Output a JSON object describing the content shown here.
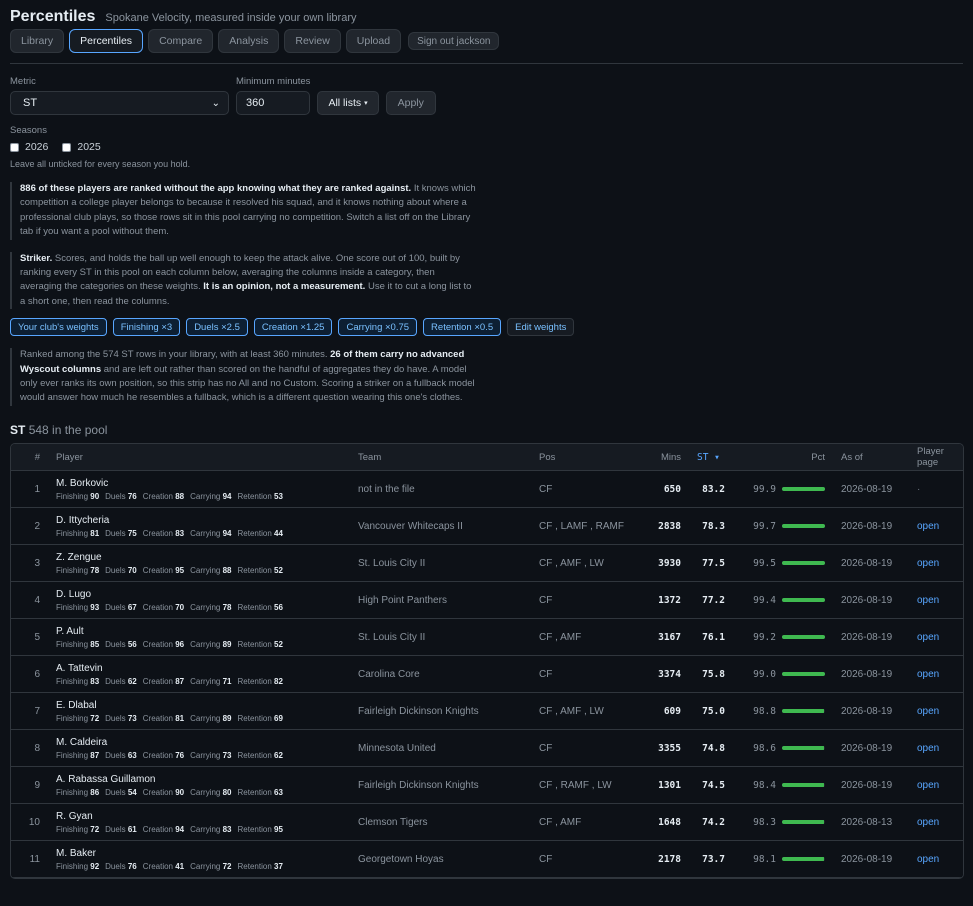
{
  "header": {
    "title": "Percentiles",
    "subtitle": "Spokane Velocity, measured inside your own library"
  },
  "nav": {
    "tabs": [
      "Library",
      "Percentiles",
      "Compare",
      "Analysis",
      "Review",
      "Upload"
    ],
    "active": "Percentiles",
    "signout": "Sign out jackson"
  },
  "filters": {
    "metric_label": "Metric",
    "metric_value": "ST",
    "minmin_label": "Minimum minutes",
    "minmin_value": "360",
    "lists_label": "All lists",
    "apply_label": "Apply",
    "seasons_label": "Seasons",
    "seasons": [
      "2026",
      "2025"
    ],
    "seasons_hint": "Leave all unticked for every season you hold."
  },
  "note1": {
    "bold": "886 of these players are ranked without the app knowing what they are ranked against.",
    "text": " It knows which competition a college player belongs to because it resolved his squad, and it knows nothing about where a professional club plays, so those rows sit in this pool carrying no competition. Switch a list off on the Library tab if you want a pool without them."
  },
  "note2": {
    "bold1": "Striker.",
    "text1": " Scores, and holds the ball up well enough to keep the attack alive. One score out of 100, built by ranking every ST in this pool on each column below, averaging the columns inside a category, then averaging the categories on these weights. ",
    "bold2": "It is an opinion, not a measurement.",
    "text2": " Use it to cut a long list to a short one, then read the columns."
  },
  "weights": {
    "pills": [
      "Your club's weights",
      "Finishing ×3",
      "Duels ×2.5",
      "Creation ×1.25",
      "Carrying ×0.75",
      "Retention ×0.5"
    ],
    "edit": "Edit weights"
  },
  "note3": {
    "text1": "Ranked among the 574 ST rows in your library, with at least 360 minutes. ",
    "bold": "26 of them carry no advanced Wyscout columns",
    "text2": " and are left out rather than scored on the handful of aggregates they do have. A model only ever ranks its own position, so this strip has no All and no Custom. Scoring a striker on a fullback model would answer how much he resembles a fullback, which is a different question wearing this one's clothes."
  },
  "section": {
    "title": "ST",
    "count": "548 in the pool"
  },
  "table": {
    "columns": [
      "#",
      "Player",
      "Team",
      "Pos",
      "Mins",
      "ST ▾",
      "Pct",
      "As of",
      "Player page"
    ],
    "sub_labels": [
      "Finishing",
      "Duels",
      "Creation",
      "Carrying",
      "Retention"
    ],
    "rows": [
      {
        "rank": "1",
        "name": "M. Borkovic",
        "subs": [
          "90",
          "76",
          "88",
          "94",
          "53"
        ],
        "team": "not in the file",
        "pos": "CF",
        "mins": "650",
        "score": "83.2",
        "pct": "99.9",
        "pct_value": 99.9,
        "asof": "2026-08-19",
        "page": "·"
      },
      {
        "rank": "2",
        "name": "D. Ittycheria",
        "subs": [
          "81",
          "75",
          "83",
          "94",
          "44"
        ],
        "team": "Vancouver Whitecaps II",
        "pos": "CF , LAMF , RAMF",
        "mins": "2838",
        "score": "78.3",
        "pct": "99.7",
        "pct_value": 99.7,
        "asof": "2026-08-19",
        "page": "open"
      },
      {
        "rank": "3",
        "name": "Z. Zengue",
        "subs": [
          "78",
          "70",
          "95",
          "88",
          "52"
        ],
        "team": "St. Louis City II",
        "pos": "CF , AMF , LW",
        "mins": "3930",
        "score": "77.5",
        "pct": "99.5",
        "pct_value": 99.5,
        "asof": "2026-08-19",
        "page": "open"
      },
      {
        "rank": "4",
        "name": "D. Lugo",
        "subs": [
          "93",
          "67",
          "70",
          "78",
          "56"
        ],
        "team": "High Point Panthers",
        "pos": "CF",
        "mins": "1372",
        "score": "77.2",
        "pct": "99.4",
        "pct_value": 99.4,
        "asof": "2026-08-19",
        "page": "open"
      },
      {
        "rank": "5",
        "name": "P. Ault",
        "subs": [
          "85",
          "56",
          "96",
          "89",
          "52"
        ],
        "team": "St. Louis City II",
        "pos": "CF , AMF",
        "mins": "3167",
        "score": "76.1",
        "pct": "99.2",
        "pct_value": 99.2,
        "asof": "2026-08-19",
        "page": "open"
      },
      {
        "rank": "6",
        "name": "A. Tattevin",
        "subs": [
          "83",
          "62",
          "87",
          "71",
          "82"
        ],
        "team": "Carolina Core",
        "pos": "CF",
        "mins": "3374",
        "score": "75.8",
        "pct": "99.0",
        "pct_value": 99.0,
        "asof": "2026-08-19",
        "page": "open"
      },
      {
        "rank": "7",
        "name": "E. Dlabal",
        "subs": [
          "72",
          "73",
          "81",
          "89",
          "69"
        ],
        "team": "Fairleigh Dickinson Knights",
        "pos": "CF , AMF , LW",
        "mins": "609",
        "score": "75.0",
        "pct": "98.8",
        "pct_value": 98.8,
        "asof": "2026-08-19",
        "page": "open"
      },
      {
        "rank": "8",
        "name": "M. Caldeira",
        "subs": [
          "87",
          "63",
          "76",
          "73",
          "62"
        ],
        "team": "Minnesota United",
        "pos": "CF",
        "mins": "3355",
        "score": "74.8",
        "pct": "98.6",
        "pct_value": 98.6,
        "asof": "2026-08-19",
        "page": "open"
      },
      {
        "rank": "9",
        "name": "A. Rabassa Guillamon",
        "subs": [
          "86",
          "54",
          "90",
          "80",
          "63"
        ],
        "team": "Fairleigh Dickinson Knights",
        "pos": "CF , RAMF , LW",
        "mins": "1301",
        "score": "74.5",
        "pct": "98.4",
        "pct_value": 98.4,
        "asof": "2026-08-19",
        "page": "open"
      },
      {
        "rank": "10",
        "name": "R. Gyan",
        "subs": [
          "72",
          "61",
          "94",
          "83",
          "95"
        ],
        "team": "Clemson Tigers",
        "pos": "CF , AMF",
        "mins": "1648",
        "score": "74.2",
        "pct": "98.3",
        "pct_value": 98.3,
        "asof": "2026-08-13",
        "page": "open"
      },
      {
        "rank": "11",
        "name": "M. Baker",
        "subs": [
          "92",
          "76",
          "41",
          "72",
          "37"
        ],
        "team": "Georgetown Hoyas",
        "pos": "CF",
        "mins": "2178",
        "score": "73.7",
        "pct": "98.1",
        "pct_value": 98.1,
        "asof": "2026-08-19",
        "page": "open"
      }
    ]
  },
  "colors": {
    "accent": "#58a6ff",
    "bar": "#3fb950",
    "bg": "#0d1117"
  }
}
